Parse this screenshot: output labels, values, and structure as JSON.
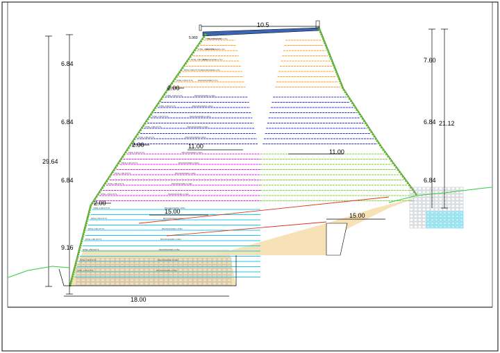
{
  "drawing": {
    "top_width": "10.5",
    "base_width": "18.00",
    "total_height": "29.64",
    "right_total_height": "21.12",
    "left_tier_heights": [
      "6.84",
      "6.84",
      "6.84",
      "9.16"
    ],
    "right_tier_heights": [
      "7.60",
      "6.84",
      "6.84"
    ],
    "left_bench_labels": [
      "2.00",
      "2.00",
      "2.00"
    ],
    "bench_widths": [
      "11.00",
      "11.00",
      "15.00",
      "15.00"
    ],
    "small_label": "5.960",
    "reinforcement_label_a": "PACCFGVG60 L=7m",
    "reinforcement_label_b": "PACCFGVG60 L=10m",
    "reinforcement_label_c": "PACCFGVG60 L=15m",
    "facing_label": "STNL 1:50 0.5 T1",
    "colors": {
      "orange": "#ff9a1f",
      "blue": "#2b2bd6",
      "magenta": "#e01ee0",
      "cyan": "#1cc8e8",
      "green": "#7fd13b",
      "red": "#e03020",
      "fill": "#f6deaf",
      "grid": "#9aa0a8"
    }
  }
}
